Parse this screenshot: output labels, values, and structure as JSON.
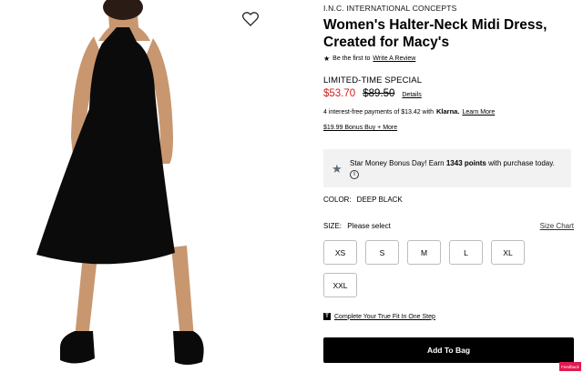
{
  "product": {
    "brand": "I.N.C. INTERNATIONAL CONCEPTS",
    "title": "Women's Halter-Neck Midi Dress, Created for Macy's",
    "review_prefix": "Be the first to",
    "review_link": "Write A Review",
    "special_label": "LIMITED-TIME SPECIAL",
    "sale_price": "$53.70",
    "original_price": "$89.50",
    "details_link": "Details",
    "klarna_text": "4 interest-free payments of $13.42 with",
    "klarna_brand": "Klarna.",
    "klarna_learn": "Learn More",
    "bonus_buy": "$19.99 Bonus Buy + More"
  },
  "promo": {
    "text_before": "Star Money Bonus Day! Earn",
    "points": "1343 points",
    "text_after": "with purchase today.",
    "info_symbol": "i"
  },
  "color": {
    "label": "COLOR:",
    "value": "DEEP BLACK"
  },
  "size": {
    "label": "SIZE:",
    "placeholder": "Please select",
    "chart_link": "Size Chart",
    "options": [
      "XS",
      "S",
      "M",
      "L",
      "XL",
      "XXL"
    ]
  },
  "fit": {
    "icon_letter": "T",
    "text": "Complete Your True Fit In One Step"
  },
  "cta": {
    "add_to_bag": "Add To Bag"
  },
  "feedback": {
    "label": "Feedback"
  },
  "colors": {
    "sale_red": "#d12121",
    "promo_bg": "#f2f2f2",
    "feedback_pink": "#e01a4f",
    "dress": "#0b0b0b",
    "skin": "#c8976f"
  },
  "icons": {
    "wishlist": "heart-outline-icon",
    "review_star": "star-icon",
    "promo_star": "star-icon",
    "info": "info-circle-icon",
    "true_fit": "true-fit-logo-icon"
  }
}
